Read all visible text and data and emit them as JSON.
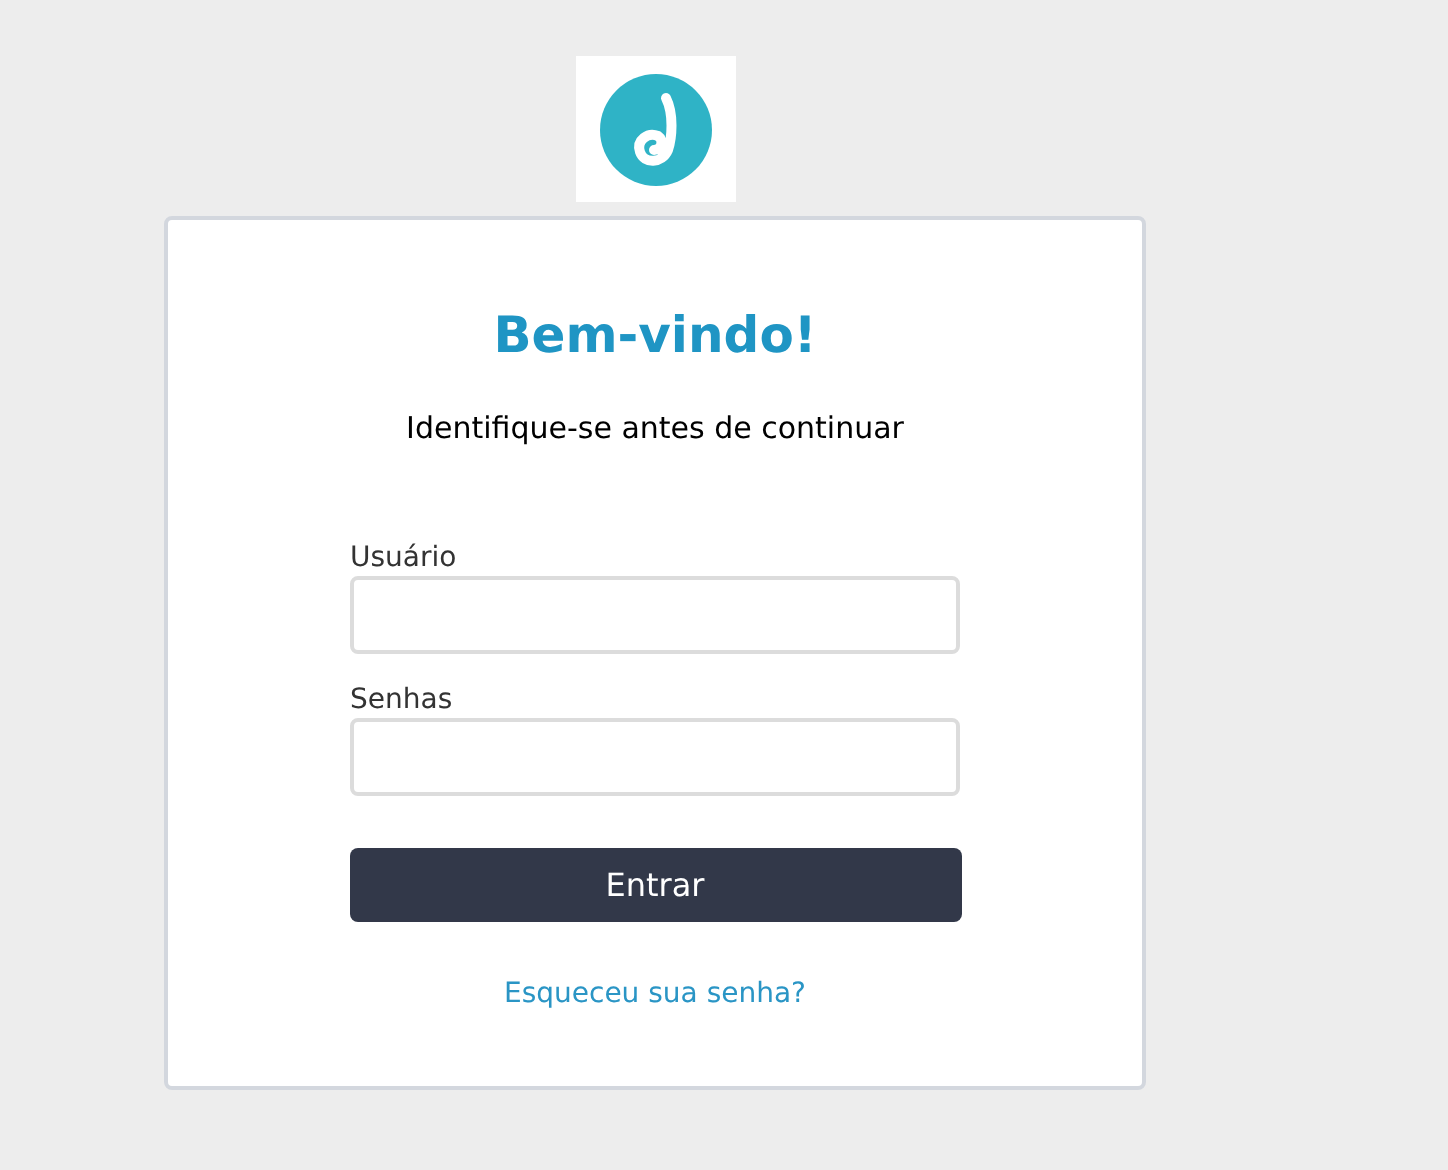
{
  "title": "Bem-vindo!",
  "subtitle": "Identifique-se antes de continuar",
  "fields": [
    {
      "label": "Usuário"
    },
    {
      "label": "Senhas"
    }
  ],
  "submit_button": "Entrar",
  "forgot_link": "Esqueceu sua senha?"
}
